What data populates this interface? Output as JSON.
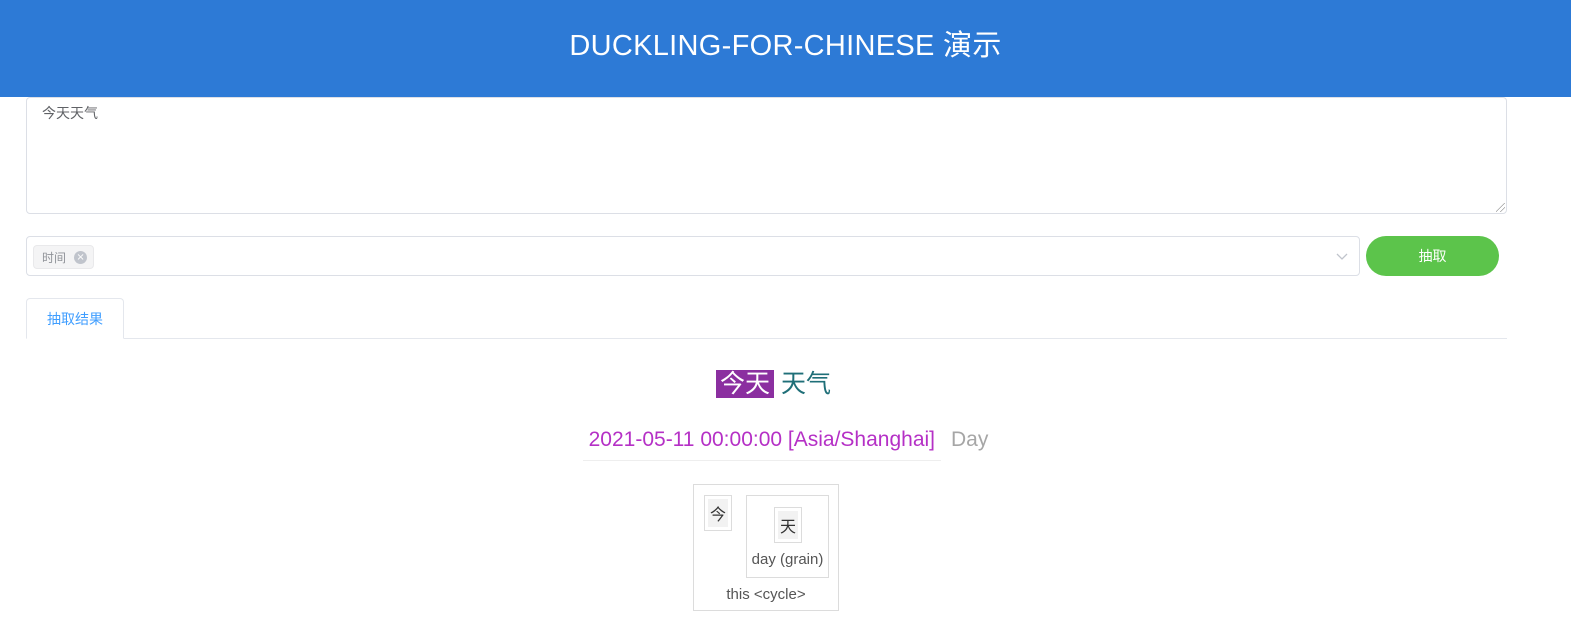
{
  "header": {
    "title": "DUCKLING-FOR-CHINESE 演示"
  },
  "input": {
    "text": "今天天气"
  },
  "dimension_select": {
    "selected_tags": [
      "时间"
    ],
    "close_glyph": "×"
  },
  "extract_button": {
    "label": "抽取"
  },
  "tabs": [
    {
      "label": "抽取结果",
      "active": true
    }
  ],
  "result": {
    "tokens": [
      {
        "text": "今天",
        "highlighted": true
      },
      {
        "text": "天气",
        "highlighted": false
      }
    ],
    "value": "2021-05-11 00:00:00 [Asia/Shanghai]",
    "grain": "Day",
    "parse_tree": {
      "rule": "this <cycle>",
      "children": [
        {
          "char": "今"
        },
        {
          "char": "天",
          "label": "day (grain)"
        }
      ]
    }
  },
  "colors": {
    "header_bg": "#2d7ad6",
    "button_bg": "#5cc44b",
    "tab_active": "#409eff",
    "token_highlight_bg": "#8b2fa0",
    "token_plain": "#1f6f78",
    "value_text": "#b530c6"
  }
}
